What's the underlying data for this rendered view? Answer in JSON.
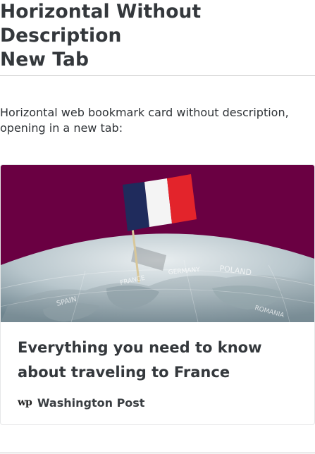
{
  "page": {
    "title_line1": "Horizontal Without Description",
    "title_line2": "New Tab",
    "intro": "Horizontal web bookmark card without description, opening in a new tab:"
  },
  "bookmark": {
    "title": "Everything you need to know about traveling to France",
    "publisher": "Washington Post",
    "publisher_logo_text": "wp",
    "image_description": "French flag toothpick stuck in a globe on a purple background",
    "colors": {
      "image_background": "#6a0042",
      "flag_blue": "#1f2b5c",
      "flag_white": "#f4f4f4",
      "flag_red": "#e3242b"
    }
  }
}
